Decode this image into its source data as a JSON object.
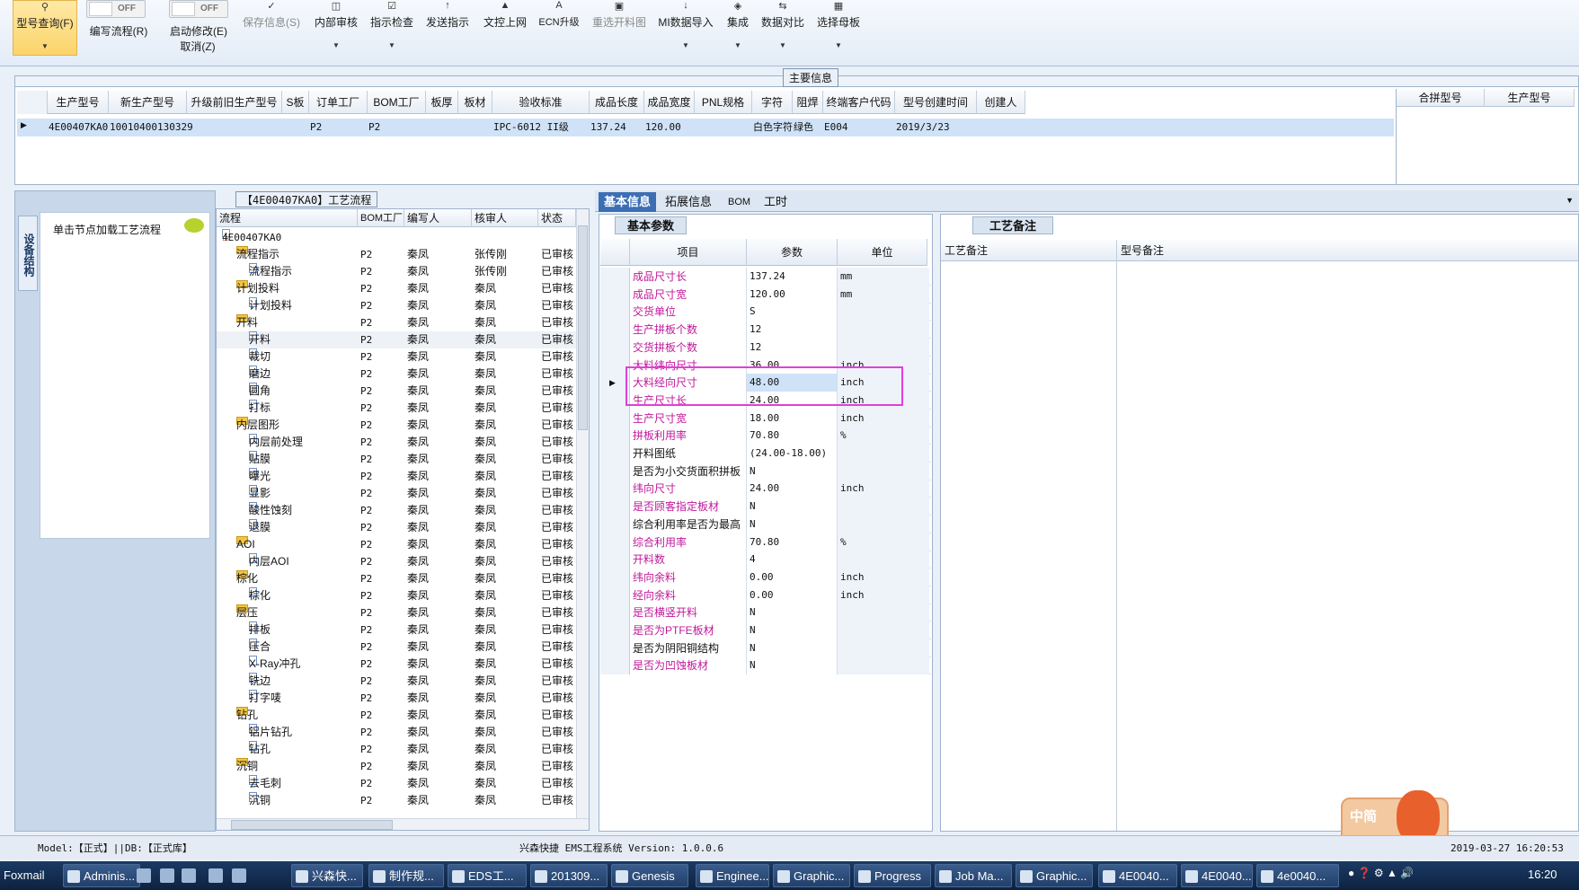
{
  "toolbar": {
    "query": "型号查询(F)",
    "edit_flow": "编写流程(R)",
    "start_edit": "启动修改(E)",
    "cancel": "取消(Z)",
    "save": "保存信息(S)",
    "internal_review": "内部审核",
    "check": "指示检查",
    "send": "发送指示",
    "upload": "文控上网",
    "ecn": "ECN升级",
    "reselect": "重选开料图",
    "mi_import": "MI数据导入",
    "integrate": "集成",
    "compare": "数据对比",
    "choose_master": "选择母板",
    "toggle_off": "OFF"
  },
  "main_info": {
    "title": "主要信息",
    "headers": [
      "生产型号",
      "新生产型号",
      "升级前旧生产型号",
      "S板",
      "订单工厂",
      "BOM工厂",
      "板厚",
      "板材",
      "验收标准",
      "成品长度",
      "成品宽度",
      "PNL规格",
      "字符",
      "阻焊",
      "终端客户代码",
      "型号创建时间",
      "创建人"
    ],
    "row": [
      "4E00407KA0",
      "10010400130329",
      "",
      "",
      "P2",
      "P2",
      "",
      "",
      "IPC-6012 II级",
      "137.24",
      "120.00",
      "",
      "白色字符",
      "绿色",
      "E004",
      "2019/3/23",
      ""
    ],
    "right_headers": [
      "合拼型号",
      "生产型号"
    ]
  },
  "left": {
    "vertical_tab": "设备结构",
    "hint": "单击节点加载工艺流程"
  },
  "flow": {
    "label": "【4E00407KA0】工艺流程",
    "headers": [
      "流程",
      "BOM工厂",
      "编写人",
      "核审人",
      "状态"
    ],
    "root": "4E00407KA0",
    "rows": [
      {
        "name": "流程指示",
        "folder": true,
        "bom": "P2",
        "writer": "秦凤",
        "reviewer": "张传刚",
        "status": "已审核"
      },
      {
        "name": "流程指示",
        "folder": false,
        "bom": "P2",
        "writer": "秦凤",
        "reviewer": "张传刚",
        "status": "已审核"
      },
      {
        "name": "计划投料",
        "folder": true,
        "bom": "P2",
        "writer": "秦凤",
        "reviewer": "秦凤",
        "status": "已审核"
      },
      {
        "name": "计划投料",
        "folder": false,
        "bom": "P2",
        "writer": "秦凤",
        "reviewer": "秦凤",
        "status": "已审核"
      },
      {
        "name": "开料",
        "folder": true,
        "bom": "P2",
        "writer": "秦凤",
        "reviewer": "秦凤",
        "status": "已审核"
      },
      {
        "name": "开料",
        "folder": false,
        "bom": "P2",
        "writer": "秦凤",
        "reviewer": "秦凤",
        "status": "已审核"
      },
      {
        "name": "裁切",
        "folder": false,
        "bom": "P2",
        "writer": "秦凤",
        "reviewer": "秦凤",
        "status": "已审核"
      },
      {
        "name": "磨边",
        "folder": false,
        "bom": "P2",
        "writer": "秦凤",
        "reviewer": "秦凤",
        "status": "已审核"
      },
      {
        "name": "圆角",
        "folder": false,
        "bom": "P2",
        "writer": "秦凤",
        "reviewer": "秦凤",
        "status": "已审核"
      },
      {
        "name": "打标",
        "folder": false,
        "bom": "P2",
        "writer": "秦凤",
        "reviewer": "秦凤",
        "status": "已审核"
      },
      {
        "name": "内层图形",
        "folder": true,
        "bom": "P2",
        "writer": "秦凤",
        "reviewer": "秦凤",
        "status": "已审核"
      },
      {
        "name": "内层前处理",
        "folder": false,
        "bom": "P2",
        "writer": "秦凤",
        "reviewer": "秦凤",
        "status": "已审核"
      },
      {
        "name": "贴膜",
        "folder": false,
        "bom": "P2",
        "writer": "秦凤",
        "reviewer": "秦凤",
        "status": "已审核"
      },
      {
        "name": "曝光",
        "folder": false,
        "bom": "P2",
        "writer": "秦凤",
        "reviewer": "秦凤",
        "status": "已审核"
      },
      {
        "name": "显影",
        "folder": false,
        "bom": "P2",
        "writer": "秦凤",
        "reviewer": "秦凤",
        "status": "已审核"
      },
      {
        "name": "酸性蚀刻",
        "folder": false,
        "bom": "P2",
        "writer": "秦凤",
        "reviewer": "秦凤",
        "status": "已审核"
      },
      {
        "name": "退膜",
        "folder": false,
        "bom": "P2",
        "writer": "秦凤",
        "reviewer": "秦凤",
        "status": "已审核"
      },
      {
        "name": "AOI",
        "folder": true,
        "bom": "P2",
        "writer": "秦凤",
        "reviewer": "秦凤",
        "status": "已审核"
      },
      {
        "name": "内层AOI",
        "folder": false,
        "bom": "P2",
        "writer": "秦凤",
        "reviewer": "秦凤",
        "status": "已审核"
      },
      {
        "name": "棕化",
        "folder": true,
        "bom": "P2",
        "writer": "秦凤",
        "reviewer": "秦凤",
        "status": "已审核"
      },
      {
        "name": "棕化",
        "folder": false,
        "bom": "P2",
        "writer": "秦凤",
        "reviewer": "秦凤",
        "status": "已审核"
      },
      {
        "name": "层压",
        "folder": true,
        "bom": "P2",
        "writer": "秦凤",
        "reviewer": "秦凤",
        "status": "已审核"
      },
      {
        "name": "排板",
        "folder": false,
        "bom": "P2",
        "writer": "秦凤",
        "reviewer": "秦凤",
        "status": "已审核"
      },
      {
        "name": "压合",
        "folder": false,
        "bom": "P2",
        "writer": "秦凤",
        "reviewer": "秦凤",
        "status": "已审核"
      },
      {
        "name": "X-Ray冲孔",
        "folder": false,
        "bom": "P2",
        "writer": "秦凤",
        "reviewer": "秦凤",
        "status": "已审核"
      },
      {
        "name": "铣边",
        "folder": false,
        "bom": "P2",
        "writer": "秦凤",
        "reviewer": "秦凤",
        "status": "已审核"
      },
      {
        "name": "打字唛",
        "folder": false,
        "bom": "P2",
        "writer": "秦凤",
        "reviewer": "秦凤",
        "status": "已审核"
      },
      {
        "name": "钻孔",
        "folder": true,
        "bom": "P2",
        "writer": "秦凤",
        "reviewer": "秦凤",
        "status": "已审核"
      },
      {
        "name": "铝片钻孔",
        "folder": false,
        "bom": "P2",
        "writer": "秦凤",
        "reviewer": "秦凤",
        "status": "已审核"
      },
      {
        "name": "钻孔",
        "folder": false,
        "bom": "P2",
        "writer": "秦凤",
        "reviewer": "秦凤",
        "status": "已审核"
      },
      {
        "name": "沉铜",
        "folder": true,
        "bom": "P2",
        "writer": "秦凤",
        "reviewer": "秦凤",
        "status": "已审核"
      },
      {
        "name": "去毛刺",
        "folder": false,
        "bom": "P2",
        "writer": "秦凤",
        "reviewer": "秦凤",
        "status": "已审核"
      },
      {
        "name": "沉铜",
        "folder": false,
        "bom": "P2",
        "writer": "秦凤",
        "reviewer": "秦凤",
        "status": "已审核"
      }
    ]
  },
  "tabs": [
    "基本信息",
    "拓展信息",
    "BOM",
    "工时"
  ],
  "basic": {
    "tab": "基本参数",
    "headers": [
      "项目",
      "参数",
      "单位"
    ],
    "rows": [
      {
        "item": "成品尺寸长",
        "value": "137.24",
        "unit": "mm",
        "color": "magenta"
      },
      {
        "item": "成品尺寸宽",
        "value": "120.00",
        "unit": "mm",
        "color": "magenta"
      },
      {
        "item": "交货单位",
        "value": "S",
        "unit": "",
        "color": "magenta"
      },
      {
        "item": "生产拼板个数",
        "value": "12",
        "unit": "",
        "color": "magenta"
      },
      {
        "item": "交货拼板个数",
        "value": "12",
        "unit": "",
        "color": "magenta"
      },
      {
        "item": "大料纬向尺寸",
        "value": "36.00",
        "unit": "inch",
        "color": "magenta"
      },
      {
        "item": "大料经向尺寸",
        "value": "48.00",
        "unit": "inch",
        "color": "magenta"
      },
      {
        "item": "生产尺寸长",
        "value": "24.00",
        "unit": "inch",
        "color": "magenta"
      },
      {
        "item": "生产尺寸宽",
        "value": "18.00",
        "unit": "inch",
        "color": "magenta"
      },
      {
        "item": "拼板利用率",
        "value": "70.80",
        "unit": "%",
        "color": "magenta"
      },
      {
        "item": "开料图纸",
        "value": "(24.00-18.00)",
        "unit": "",
        "color": "black"
      },
      {
        "item": "是否为小交货面积拼板",
        "value": "N",
        "unit": "",
        "color": "black"
      },
      {
        "item": "纬向尺寸",
        "value": "24.00",
        "unit": "inch",
        "color": "magenta"
      },
      {
        "item": "是否顾客指定板材",
        "value": "N",
        "unit": "",
        "color": "magenta"
      },
      {
        "item": "综合利用率是否为最高",
        "value": "N",
        "unit": "",
        "color": "black"
      },
      {
        "item": "综合利用率",
        "value": "70.80",
        "unit": "%",
        "color": "magenta"
      },
      {
        "item": "开料数",
        "value": "4",
        "unit": "",
        "color": "magenta"
      },
      {
        "item": "纬向余料",
        "value": "0.00",
        "unit": "inch",
        "color": "magenta"
      },
      {
        "item": "经向余料",
        "value": "0.00",
        "unit": "inch",
        "color": "magenta"
      },
      {
        "item": "是否横竖开料",
        "value": "N",
        "unit": "",
        "color": "magenta"
      },
      {
        "item": "是否为PTFE板材",
        "value": "N",
        "unit": "",
        "color": "magenta"
      },
      {
        "item": "是否为阴阳铜结构",
        "value": "N",
        "unit": "",
        "color": "black"
      },
      {
        "item": "是否为凹蚀板材",
        "value": "N",
        "unit": "",
        "color": "magenta"
      }
    ]
  },
  "notes": {
    "tab": "工艺备注",
    "col1": "工艺备注",
    "col2": "型号备注"
  },
  "status": {
    "left": "Model:【正式】||DB:【正式库】",
    "center": "兴森快捷 EMS工程系统 Version: 1.0.0.6",
    "right": "2019-03-27 16:20:53"
  },
  "ime": "中简",
  "taskbar": {
    "items": [
      "Foxmail",
      "Adminis...",
      "兴森快...",
      "制作规...",
      "EDS工...",
      "201309...",
      "Genesis",
      "Enginee...",
      "Graphic...",
      "Progress",
      "Job Ma...",
      "Graphic...",
      "4E0040...",
      "4E0040...",
      "4e0040..."
    ],
    "clock": "16:20"
  },
  "colors": {
    "magenta": "#c0189a",
    "accent": "#3c6eb4",
    "highlight": "#e040d8",
    "selected_row": "#cfe2f7"
  }
}
